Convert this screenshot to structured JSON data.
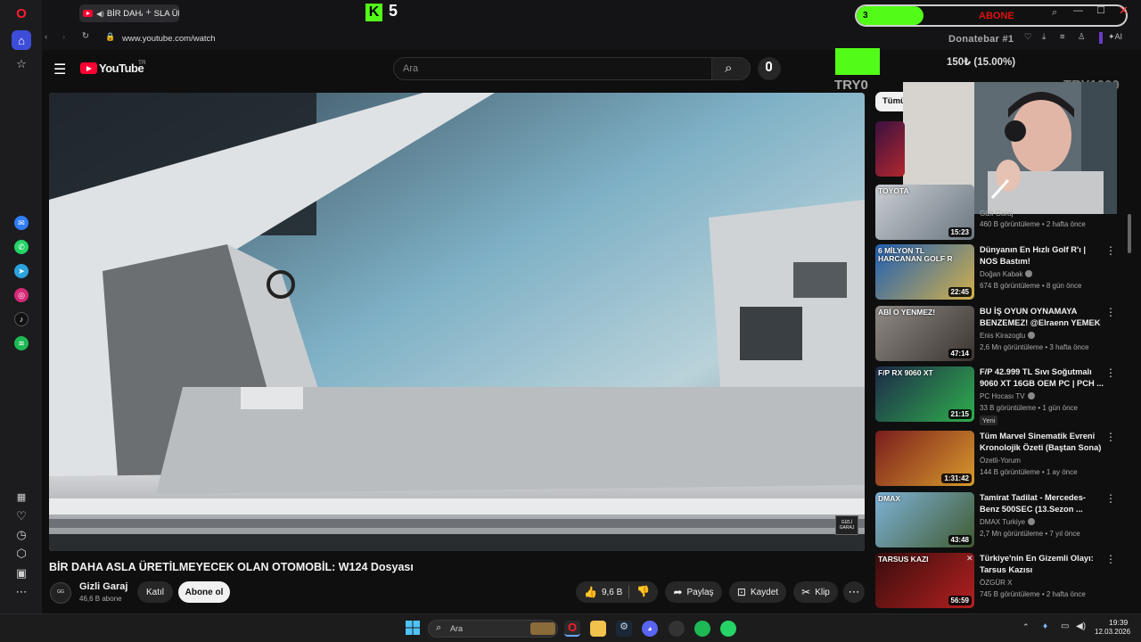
{
  "browser": {
    "tab_title": "BİR DAHA ASLA ÜRETİ",
    "url": "www.youtube.com/watch"
  },
  "youtube": {
    "logo_text": "YouTube",
    "region": "TR",
    "search_placeholder": "Ara"
  },
  "overlay": {
    "kick_count": "5",
    "goal_level": "3",
    "goal_label": "ABONE",
    "donation_title": "Donatebar #1",
    "donation_amount": "150₺ (15.00%)",
    "donation_min": "TRY0",
    "donation_max": "TRY1000",
    "filter_chip": "Tümü"
  },
  "video": {
    "title": "BİR DAHA ASLA ÜRETİLMEYECEK OLAN OTOMOBİL: W124 Dosyası",
    "channel_name": "Gizli Garaj",
    "subscribers": "46,6 B abone",
    "join_label": "Katıl",
    "subscribe_label": "Abone ol",
    "likes": "9,6 B",
    "share_label": "Paylaş",
    "save_label": "Kaydet",
    "clip_label": "Klip",
    "watermark": "GİZLİ GARAJ"
  },
  "recommendations": [
    {
      "title": "",
      "channel": "Gizli Garaj",
      "meta": "460 B görüntüleme • 2 hafta önce",
      "duration": "15:23",
      "thumb_text": "TOYOTA",
      "colors": [
        "#c9ced3",
        "#6b7680"
      ]
    },
    {
      "title": "Dünyanın En Hızlı Golf R'ı | NOS Bastım!",
      "channel": "Doğan Kabak",
      "meta": "674 B görüntüleme • 8 gün önce",
      "duration": "22:45",
      "thumb_text": "6 MİLYON TL HARCANAN GOLF R",
      "colors": [
        "#1f5fb5",
        "#d2b04a"
      ]
    },
    {
      "title": "BU İŞ OYUN OYNAMAYA BENZEMEZ! @Elraenn YEMEK ...",
      "channel": "Enis Kirazoglu",
      "meta": "2,6 Mn görüntüleme • 3 hafta önce",
      "duration": "47:14",
      "thumb_text": "ABİ O YENMEZ!",
      "colors": [
        "#8f8a86",
        "#3b3431"
      ]
    },
    {
      "title": "F/P 42.999 TL Sıvı Soğutmalı 9060 XT 16GB OEM PC | PCH ...",
      "channel": "PC Hocası TV",
      "meta": "33 B görüntüleme • 1 gün önce",
      "duration": "21:15",
      "badge": "Yeni",
      "thumb_text": "F/P RX 9060 XT",
      "colors": [
        "#1d2a4a",
        "#2fae4c"
      ]
    },
    {
      "title": "Tüm Marvel Sinematik Evreni Kronolojik Özeti (Baştan Sona)",
      "channel": "Özetli-Yorum",
      "meta": "144 B görüntüleme • 1 ay önce",
      "duration": "1:31:42",
      "thumb_text": "",
      "colors": [
        "#7a1d1d",
        "#d89a2c"
      ]
    },
    {
      "title": "Tamirat Tadilat - Mercedes-Benz 500SEC (13.Sezon ...",
      "channel": "DMAX Turkiye",
      "meta": "2,7 Mn görüntüleme • 7 yıl önce",
      "duration": "43:48",
      "thumb_text": "DMAX",
      "colors": [
        "#7fb3d8",
        "#3f5a2f"
      ]
    },
    {
      "title": "Türkiye'nin En Gizemli Olayı: Tarsus Kazısı",
      "channel": "ÖZGÜR X",
      "meta": "745 B görüntüleme • 2 hafta önce",
      "duration": "56:59",
      "thumb_text": "TARSUS KAZI",
      "colors": [
        "#3a0d0d",
        "#b32020"
      ]
    }
  ],
  "taskbar": {
    "search_placeholder": "Ara",
    "time": "19:39",
    "date": "12.03.2026"
  },
  "theme": {
    "accent_red": "#ff0033",
    "opera_red": "#ff1b2d",
    "kick_green": "#53fc18",
    "bg_dark": "#0f0f0f"
  }
}
